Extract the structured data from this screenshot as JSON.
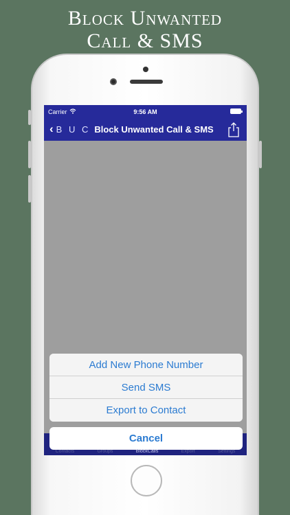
{
  "headline": {
    "line1": "Block Unwanted",
    "line2": "Call & SMS"
  },
  "status_bar": {
    "carrier": "Carrier",
    "time": "9:56 AM",
    "wifi_icon": "wifi-icon",
    "battery_icon": "battery-icon"
  },
  "nav_bar": {
    "back_label": "B U C",
    "title": "Block Unwanted Call & SMS",
    "back_icon": "chevron-left-icon",
    "share_icon": "share-icon"
  },
  "action_sheet": {
    "items": [
      {
        "label": "Add New Phone Number"
      },
      {
        "label": "Send SMS"
      },
      {
        "label": "Export to Contact"
      }
    ],
    "cancel_label": "Cancel"
  },
  "tab_bar": {
    "tabs": [
      {
        "label": "Contacts"
      },
      {
        "label": "Groups"
      },
      {
        "label": "BlockCalls"
      },
      {
        "label": "Export"
      },
      {
        "label": "Settings"
      }
    ],
    "active_index": 2
  },
  "colors": {
    "background": "#5b7560",
    "bar": "#262a9a",
    "action_text": "#2b7bd1"
  }
}
